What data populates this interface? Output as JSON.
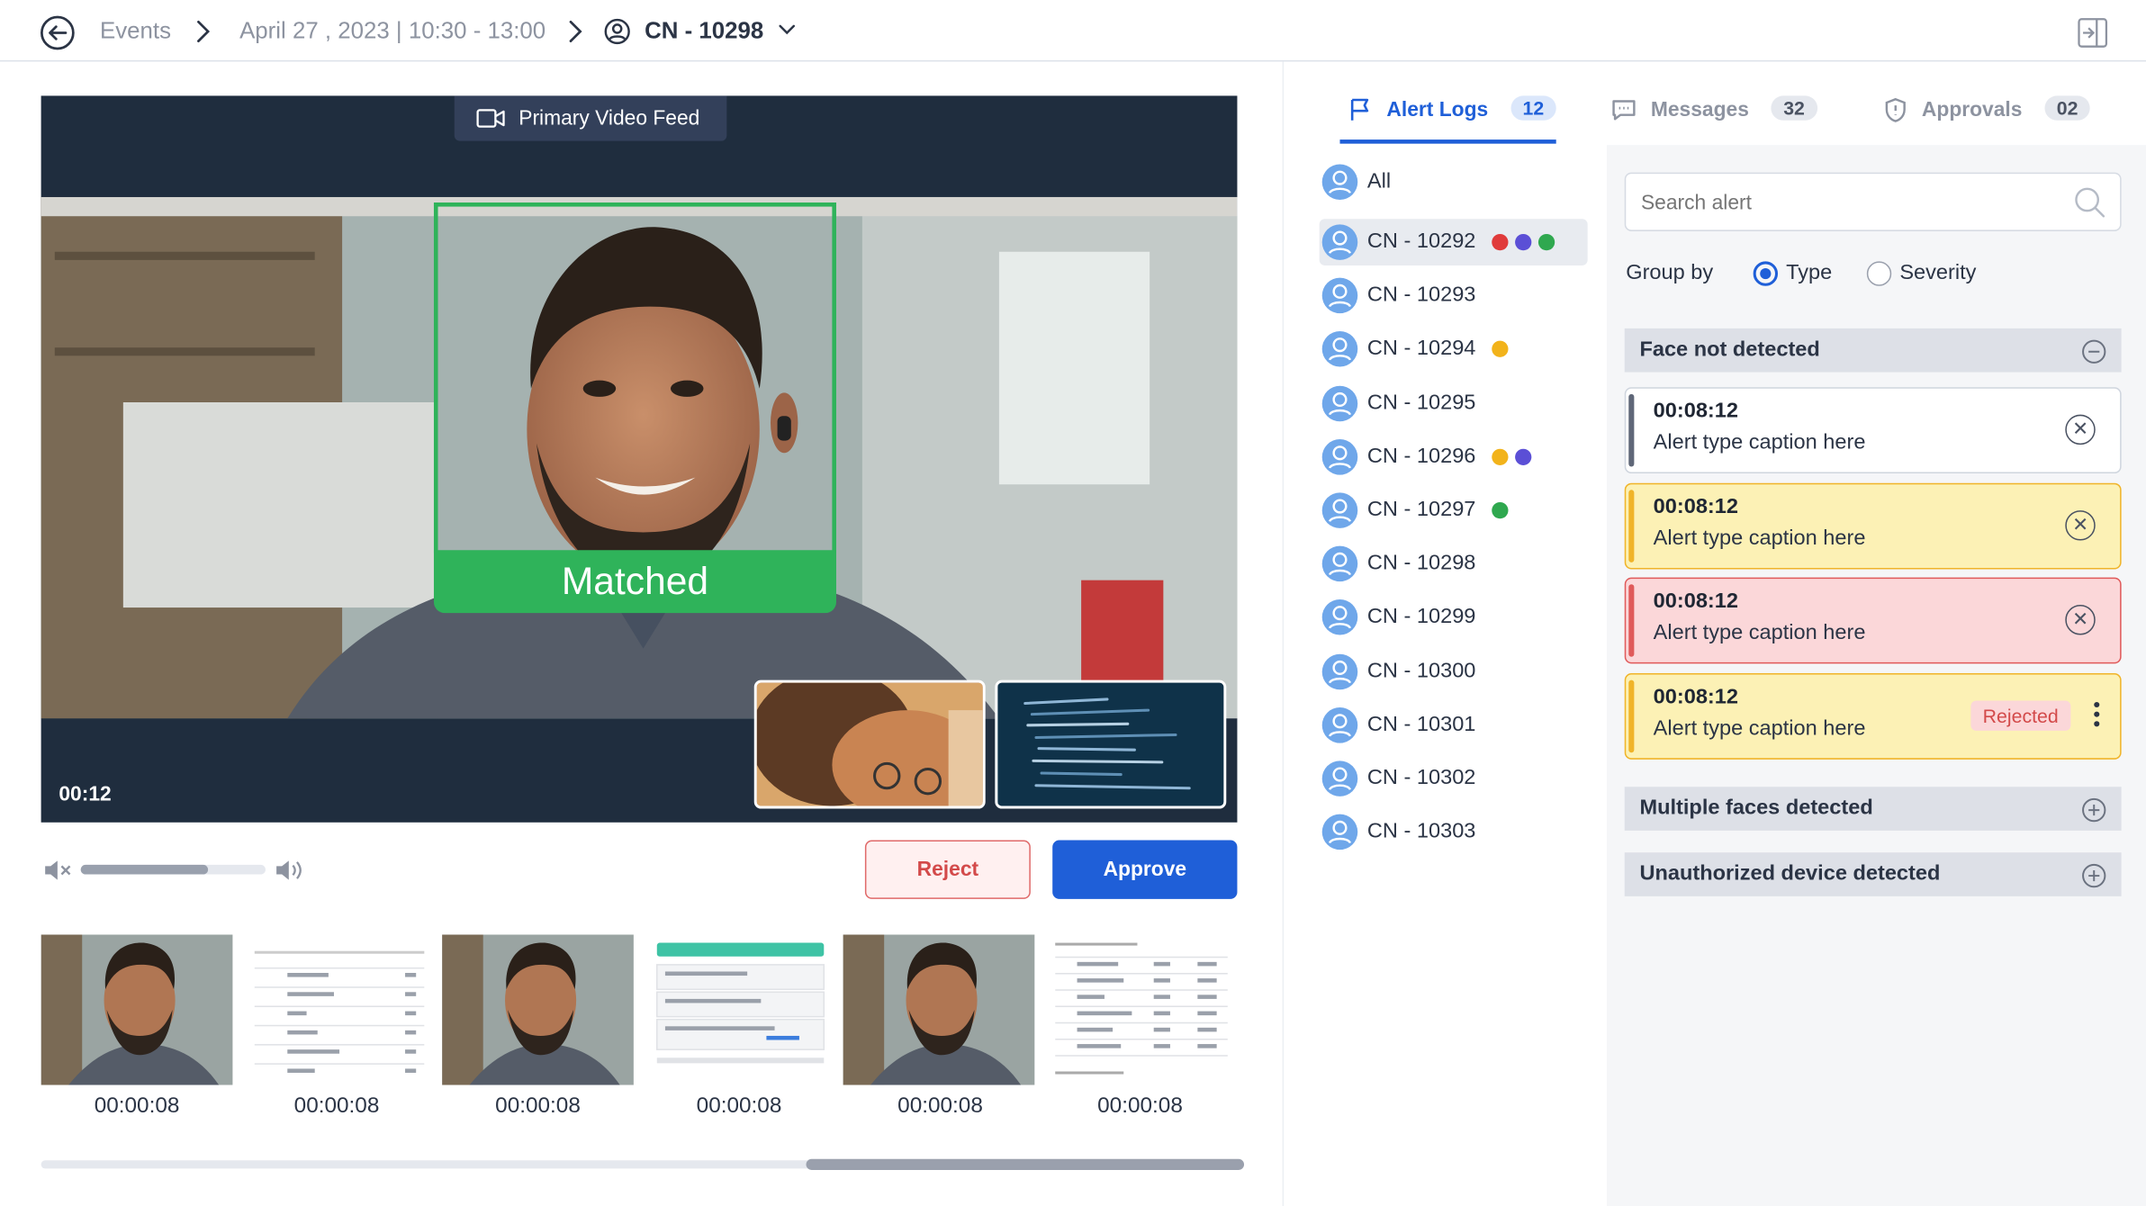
{
  "header": {
    "crumb_events": "Events",
    "crumb_date": "April 27 , 2023 | 10:30 - 13:00",
    "crumb_candidate": "CN - 10298"
  },
  "video": {
    "feed_label": "Primary Video Feed",
    "match_label": "Matched",
    "timestamp": "00:12",
    "volume_level": 0.69
  },
  "actions": {
    "reject_label": "Reject",
    "approve_label": "Approve"
  },
  "filmstrip": {
    "times": [
      "00:00:08",
      "00:00:08",
      "00:00:08",
      "00:00:08",
      "00:00:08",
      "00:00:08"
    ],
    "scroll_position": 0.64
  },
  "tabs": {
    "alert_logs": {
      "label": "Alert Logs",
      "count": "12"
    },
    "messages": {
      "label": "Messages",
      "count": "32"
    },
    "approvals": {
      "label": "Approvals",
      "count": "02"
    }
  },
  "candidates": {
    "all_label": "All",
    "items": [
      {
        "label": "CN - 10292",
        "icons": [
          "red",
          "blue",
          "green"
        ]
      },
      {
        "label": "CN - 10293",
        "icons": []
      },
      {
        "label": "CN - 10294",
        "icons": [
          "yellow"
        ]
      },
      {
        "label": "CN - 10295",
        "icons": []
      },
      {
        "label": "CN - 10296",
        "icons": [
          "yellow",
          "blue"
        ]
      },
      {
        "label": "CN - 10297",
        "icons": [
          "green"
        ]
      },
      {
        "label": "CN - 10298",
        "icons": []
      },
      {
        "label": "CN - 10299",
        "icons": []
      },
      {
        "label": "CN - 10300",
        "icons": []
      },
      {
        "label": "CN - 10301",
        "icons": []
      },
      {
        "label": "CN - 10302",
        "icons": []
      },
      {
        "label": "CN - 10303",
        "icons": []
      }
    ]
  },
  "alerts": {
    "search_placeholder": "Search alert",
    "group_by_label": "Group by",
    "group_type": "Type",
    "group_severity": "Severity",
    "groups": {
      "face_not_detected": "Face not detected",
      "multiple_faces": "Multiple faces detected",
      "unauthorized_device": "Unauthorized device detected"
    },
    "cards": [
      {
        "time": "00:08:12",
        "caption": "Alert type caption here",
        "color": "#5f6778",
        "bg": "#ffffff"
      },
      {
        "time": "00:08:12",
        "caption": "Alert type caption here",
        "color": "#f0b429",
        "bg": "#fcf1b5"
      },
      {
        "time": "00:08:12",
        "caption": "Alert type caption here",
        "color": "#e05a5a",
        "bg": "#fbd7d9"
      },
      {
        "time": "00:08:12",
        "caption": "Alert type caption here",
        "color": "#f0b429",
        "bg": "#fcf1b5",
        "status": "Rejected"
      }
    ]
  },
  "colors": {
    "accent": "#1f5fd8",
    "match_green": "#2fb35a",
    "reject_border": "#e06a6a"
  }
}
